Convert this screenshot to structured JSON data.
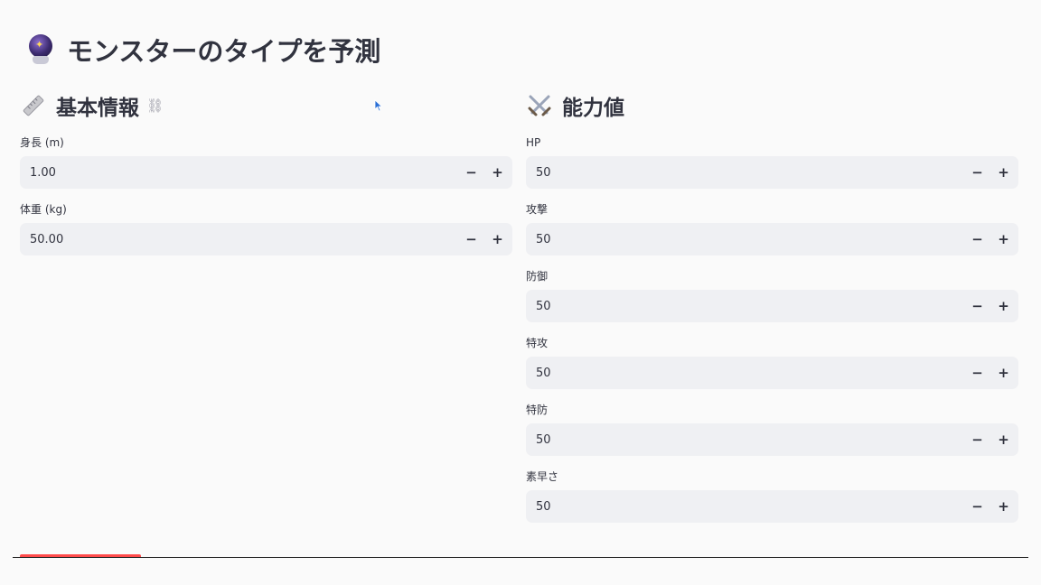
{
  "title": {
    "text": "モンスターのタイプを予測",
    "icon": "crystal-ball-icon"
  },
  "basic": {
    "heading": "基本情報",
    "icon": "ruler-icon",
    "height": {
      "label": "身長 (m)",
      "value": "1.00"
    },
    "weight": {
      "label": "体重 (kg)",
      "value": "50.00"
    }
  },
  "stats": {
    "heading": "能力値",
    "icon": "crossed-swords-icon",
    "hp": {
      "label": "HP",
      "value": "50"
    },
    "attack": {
      "label": "攻撃",
      "value": "50"
    },
    "defense": {
      "label": "防御",
      "value": "50"
    },
    "sp_attack": {
      "label": "特攻",
      "value": "50"
    },
    "sp_defense": {
      "label": "特防",
      "value": "50"
    },
    "speed": {
      "label": "素早さ",
      "value": "50"
    }
  },
  "stepper": {
    "minus": "−",
    "plus": "+"
  },
  "colors": {
    "input_bg": "#eff0f3",
    "text": "#31333f",
    "accent": "#ff4b4b",
    "page_bg": "#fafafa"
  }
}
